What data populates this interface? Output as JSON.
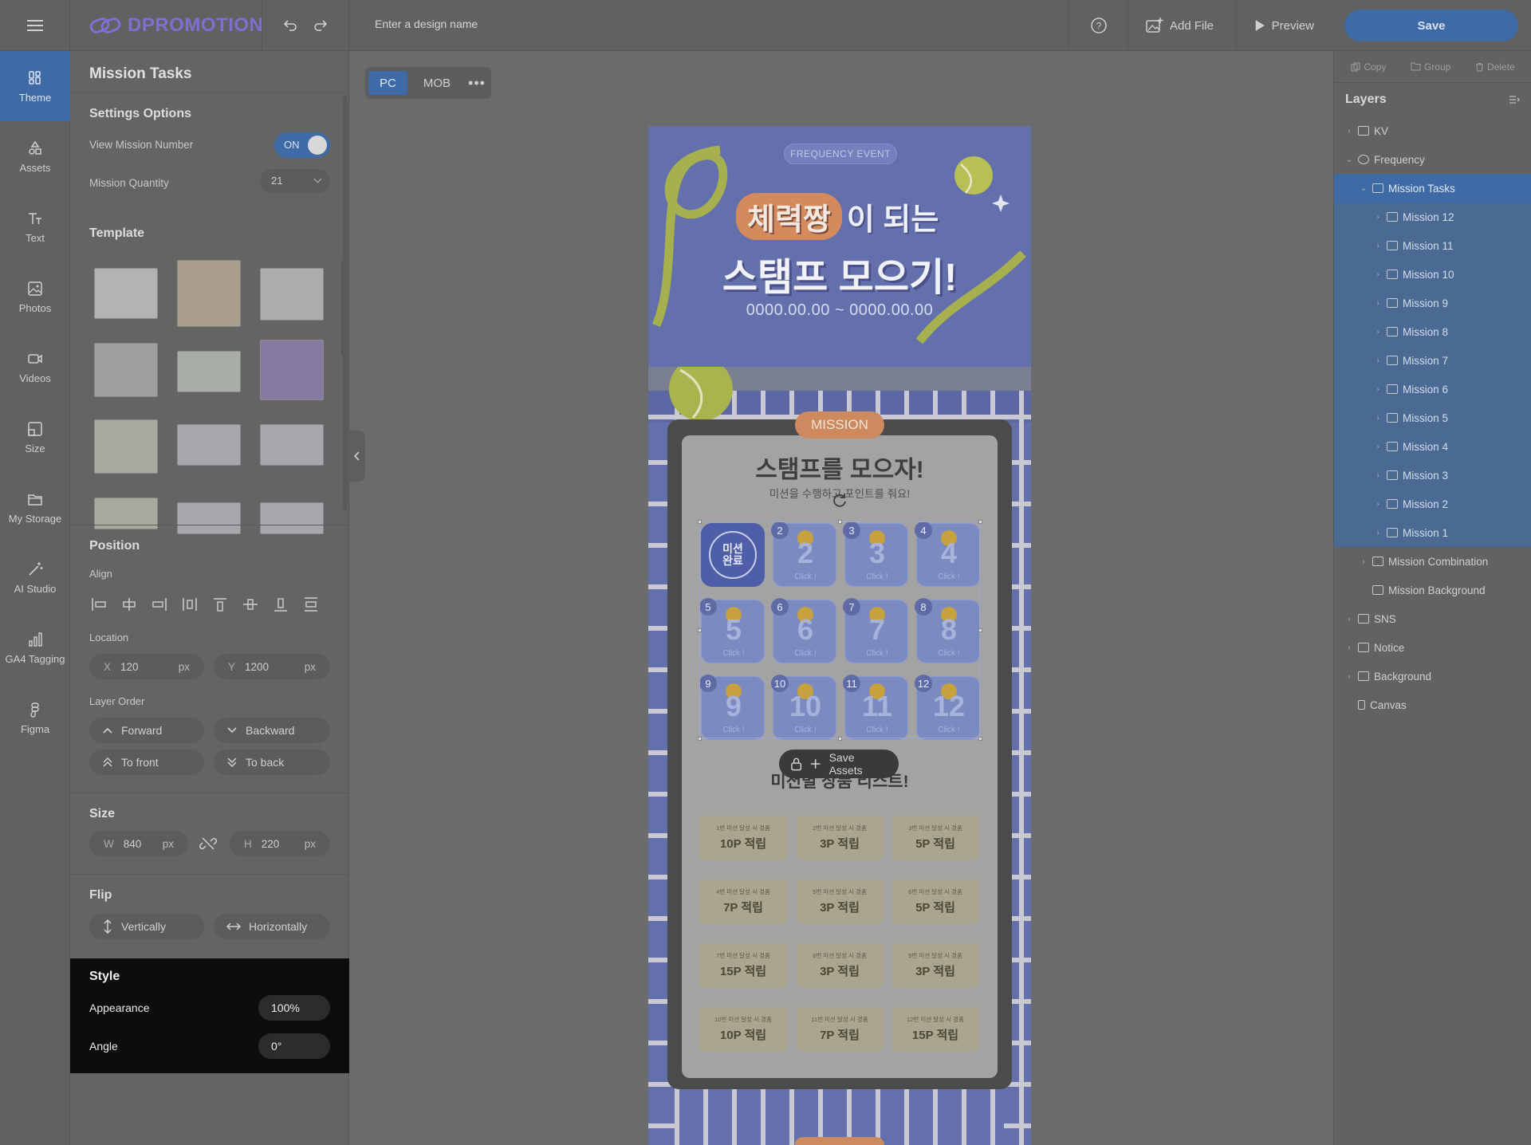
{
  "header": {
    "brand": "DPROMOTION",
    "design_name_placeholder": "Enter a design name",
    "add_file": "Add File",
    "preview": "Preview",
    "save": "Save"
  },
  "nav": [
    {
      "label": "Theme",
      "icon": "theme-icon",
      "active": true
    },
    {
      "label": "Assets",
      "icon": "assets-icon"
    },
    {
      "label": "Text",
      "icon": "text-icon"
    },
    {
      "label": "Photos",
      "icon": "photos-icon"
    },
    {
      "label": "Videos",
      "icon": "videos-icon"
    },
    {
      "label": "Size",
      "icon": "size-icon"
    },
    {
      "label": "My Storage",
      "icon": "folder-icon"
    },
    {
      "label": "AI Studio",
      "icon": "magic-wand-icon"
    },
    {
      "label": "GA4 Tagging",
      "icon": "bar-chart-icon"
    },
    {
      "label": "Figma",
      "icon": "figma-icon"
    }
  ],
  "panel": {
    "title": "Mission Tasks",
    "settings_title": "Settings Options",
    "view_mission_number": "View Mission Number",
    "toggle_state": "ON",
    "mission_quantity_label": "Mission Quantity",
    "mission_quantity": "21",
    "template_title": "Template",
    "position_title": "Position",
    "align_label": "Align",
    "location_label": "Location",
    "x_prefix": "X",
    "x_value": "120",
    "y_prefix": "Y",
    "y_value": "1200",
    "unit": "px",
    "layer_order_label": "Layer Order",
    "forward": "Forward",
    "backward": "Backward",
    "to_front": "To front",
    "to_back": "To back",
    "size_title": "Size",
    "w_prefix": "W",
    "w_value": "840",
    "h_prefix": "H",
    "h_value": "220",
    "flip_title": "Flip",
    "vertically": "Vertically",
    "horizontally": "Horizontally"
  },
  "style": {
    "title": "Style",
    "appearance_label": "Appearance",
    "appearance_value": "100%",
    "angle_label": "Angle",
    "angle_value": "0°"
  },
  "canvas": {
    "tabs": [
      "PC",
      "MOB"
    ],
    "active_tab": "PC",
    "more": "•••"
  },
  "design": {
    "frequency_pill": "FREQUENCY EVENT",
    "headline_badge": "체력짱",
    "headline_rest": "이 되는",
    "headline2": "스탬프 모으기!",
    "dates": "0000.00.00 ~ 0000.00.00",
    "mission_tag": "MISSION",
    "board_title": "스탬프를 모으자!",
    "board_subtitle": "미션을 수행하고 포인트를 줘요!",
    "done_stamp": "미션\n완료",
    "click_label": "Click !",
    "stamps": [
      "2",
      "3",
      "4",
      "5",
      "6",
      "7",
      "8",
      "9",
      "10",
      "11",
      "12"
    ],
    "save_assets": "Save Assets",
    "reward_title": "미션별 상품 리스트!",
    "rewards": [
      {
        "label": "1번 미션 달성 시 경품",
        "value": "10P 적립"
      },
      {
        "label": "2번 미션 달성 시 경품",
        "value": "3P 적립"
      },
      {
        "label": "3번 미션 달성 시 경품",
        "value": "5P 적립"
      },
      {
        "label": "4번 미션 달성 시 경품",
        "value": "7P 적립"
      },
      {
        "label": "5번 미션 달성 시 경품",
        "value": "3P 적립"
      },
      {
        "label": "6번 미션 달성 시 경품",
        "value": "5P 적립"
      },
      {
        "label": "7번 미션 달성 시 경품",
        "value": "15P 적립"
      },
      {
        "label": "8번 미션 달성 시 경품",
        "value": "3P 적립"
      },
      {
        "label": "9번 미션 달성 시 경품",
        "value": "3P 적립"
      },
      {
        "label": "10번 미션 달성 시 경품",
        "value": "10P 적립"
      },
      {
        "label": "11번 미션 달성 시 경품",
        "value": "7P 적립"
      },
      {
        "label": "12번 미션 달성 시 경품",
        "value": "15P 적립"
      }
    ]
  },
  "right_panel": {
    "copy": "Copy",
    "group": "Group",
    "delete": "Delete",
    "layers_title": "Layers",
    "layers": [
      {
        "label": "KV",
        "type": "folder",
        "depth": 0,
        "caret": true
      },
      {
        "label": "Frequency",
        "type": "group",
        "depth": 0,
        "caret": true,
        "open": true
      },
      {
        "label": "Mission Tasks",
        "type": "list",
        "depth": 1,
        "caret": true,
        "open": true,
        "state": "selected"
      },
      {
        "label": "Mission 12",
        "type": "list",
        "depth": 2,
        "caret": true,
        "state": "highlight"
      },
      {
        "label": "Mission 11",
        "type": "list",
        "depth": 2,
        "caret": true,
        "state": "highlight"
      },
      {
        "label": "Mission 10",
        "type": "list",
        "depth": 2,
        "caret": true,
        "state": "highlight"
      },
      {
        "label": "Mission 9",
        "type": "list",
        "depth": 2,
        "caret": true,
        "state": "highlight"
      },
      {
        "label": "Mission 8",
        "type": "list",
        "depth": 2,
        "caret": true,
        "state": "highlight"
      },
      {
        "label": "Mission 7",
        "type": "list",
        "depth": 2,
        "caret": true,
        "state": "highlight"
      },
      {
        "label": "Mission 6",
        "type": "list",
        "depth": 2,
        "caret": true,
        "state": "highlight"
      },
      {
        "label": "Mission 5",
        "type": "list",
        "depth": 2,
        "caret": true,
        "state": "highlight"
      },
      {
        "label": "Mission 4",
        "type": "list",
        "depth": 2,
        "caret": true,
        "state": "highlight"
      },
      {
        "label": "Mission 3",
        "type": "list",
        "depth": 2,
        "caret": true,
        "state": "highlight"
      },
      {
        "label": "Mission 2",
        "type": "list",
        "depth": 2,
        "caret": true,
        "state": "highlight"
      },
      {
        "label": "Mission 1",
        "type": "list",
        "depth": 2,
        "caret": true,
        "state": "highlight"
      },
      {
        "label": "Mission Combination",
        "type": "stack",
        "depth": 1,
        "caret": true
      },
      {
        "label": "Mission Background",
        "type": "frame",
        "depth": 1,
        "caret": false
      },
      {
        "label": "SNS",
        "type": "folder",
        "depth": 0,
        "caret": true
      },
      {
        "label": "Notice",
        "type": "folder",
        "depth": 0,
        "caret": true
      },
      {
        "label": "Background",
        "type": "folder",
        "depth": 0,
        "caret": true
      },
      {
        "label": "Canvas",
        "type": "canvas",
        "depth": 0,
        "caret": false
      }
    ]
  }
}
